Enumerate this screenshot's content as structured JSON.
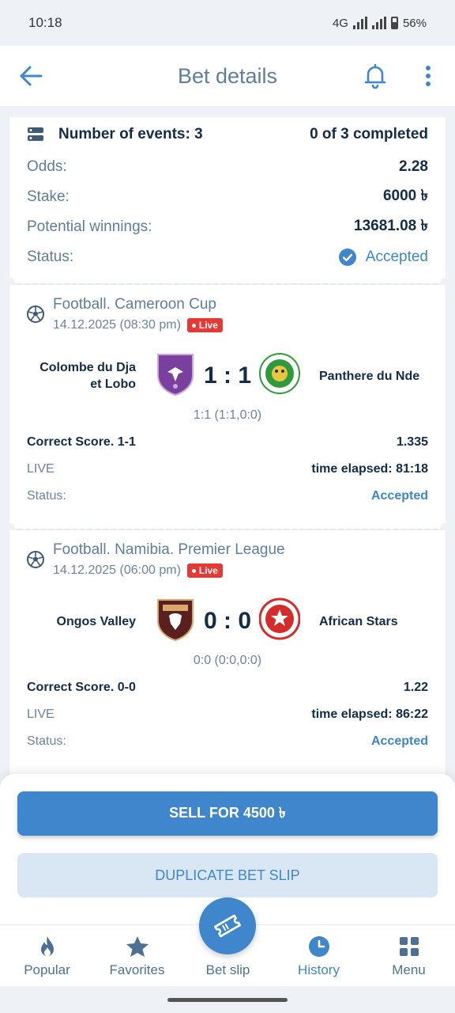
{
  "status_bar": {
    "time": "10:18",
    "network": "4G",
    "battery": "56%"
  },
  "app_bar": {
    "title": "Bet details"
  },
  "summary": {
    "events_label": "Number of events: 3",
    "completed": "0 of 3 completed",
    "odds_label": "Odds:",
    "odds_value": "2.28",
    "stake_label": "Stake:",
    "stake_value": "6000 ৳",
    "winnings_label": "Potential winnings:",
    "winnings_value": "13681.08 ৳",
    "status_label": "Status:",
    "status_value": "Accepted"
  },
  "events": [
    {
      "title": "Football. Cameroon Cup",
      "date": "14.12.2025 (08:30 pm)",
      "live_badge": "Live",
      "team_home_1": "Colombe du Dja",
      "team_home_2": "et Lobo",
      "team_away": "Panthere du Nde",
      "score": "1 : 1",
      "sub_score": "1:1 (1:1,0:0)",
      "bet_label": "Correct Score. 1-1",
      "bet_odds": "1.335",
      "live_label": "LIVE",
      "time_elapsed": "time elapsed: 81:18",
      "status_label": "Status:",
      "status_value": "Accepted",
      "home_color": "#7b3fa0",
      "away_color": "#2e9a3c"
    },
    {
      "title": "Football. Namibia. Premier League",
      "date": "14.12.2025 (06:00 pm)",
      "live_badge": "Live",
      "team_home_1": "Ongos Valley",
      "team_home_2": "",
      "team_away": "African Stars",
      "score": "0 : 0",
      "sub_score": "0:0 (0:0,0:0)",
      "bet_label": "Correct Score. 0-0",
      "bet_odds": "1.22",
      "live_label": "LIVE",
      "time_elapsed": "time elapsed: 86:22",
      "status_label": "Status:",
      "status_value": "Accepted",
      "home_color": "#7a2a2a",
      "away_color": "#d62b2b"
    }
  ],
  "actions": {
    "sell": "SELL FOR 4500 ৳",
    "duplicate": "DUPLICATE BET SLIP"
  },
  "nav": [
    {
      "label": "Popular",
      "icon": "flame-icon"
    },
    {
      "label": "Favorites",
      "icon": "star-icon"
    },
    {
      "label": "Bet slip",
      "icon": "ticket-icon"
    },
    {
      "label": "History",
      "icon": "clock-icon"
    },
    {
      "label": "Menu",
      "icon": "grid-icon"
    }
  ],
  "colors": {
    "accent": "#3f86cd",
    "background": "#eef1f6",
    "live": "#e53935"
  }
}
